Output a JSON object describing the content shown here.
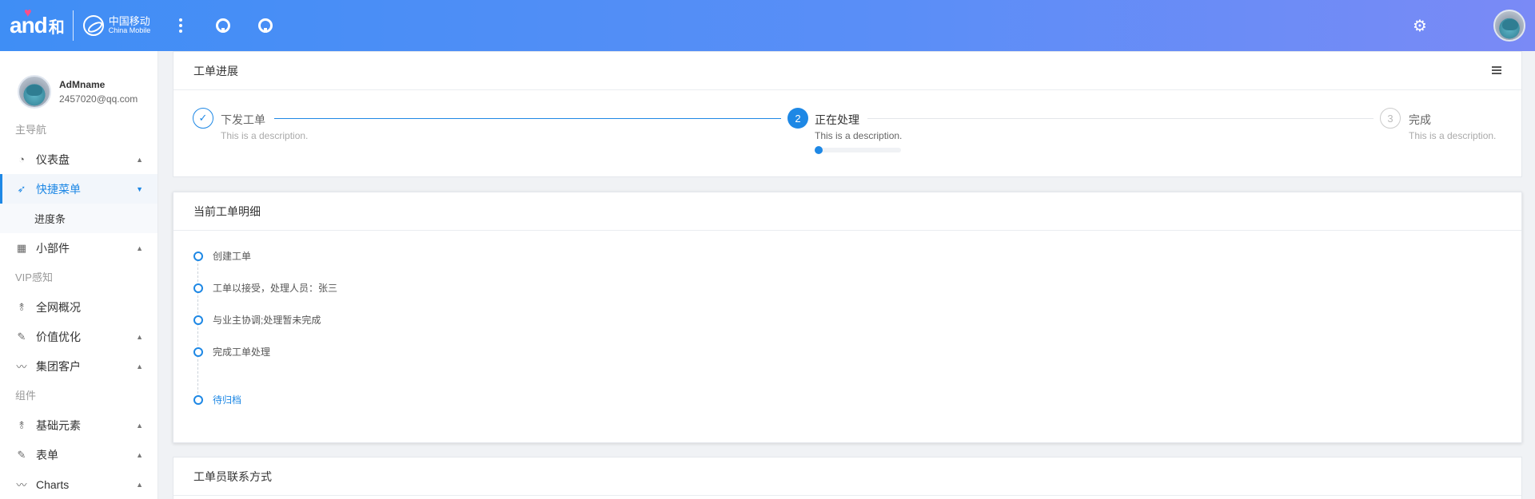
{
  "header": {
    "brand_and": "and",
    "brand_he": "和",
    "cm_zh": "中国移动",
    "cm_en": "China Mobile",
    "icons": [
      "more-vertical-icon",
      "github-icon",
      "github-icon",
      "gear-icon",
      "user-avatar"
    ]
  },
  "sidebar": {
    "user_name": "AdMname",
    "user_email": "2457020@qq.com",
    "groups": [
      {
        "label": "主导航"
      },
      {
        "label": "VIP感知"
      },
      {
        "label": "组件"
      }
    ],
    "items": [
      {
        "label": "仪表盘",
        "icon": "dashboard-icon"
      },
      {
        "label": "快捷菜单",
        "icon": "rocket-icon",
        "active": true
      },
      {
        "label": "进度条",
        "sub": true
      },
      {
        "label": "小部件",
        "icon": "grid-icon"
      },
      {
        "label": "全网概况",
        "icon": "tower-icon"
      },
      {
        "label": "价值优化",
        "icon": "edit-icon"
      },
      {
        "label": "集团客户",
        "icon": "trend-icon"
      },
      {
        "label": "基础元素",
        "icon": "tower-icon"
      },
      {
        "label": "表单",
        "icon": "edit-icon"
      },
      {
        "label": "Charts",
        "icon": "trend-icon"
      }
    ]
  },
  "progress_card": {
    "title": "工单进展",
    "steps": [
      {
        "number": "✓",
        "title": "下发工单",
        "desc": "This is a description."
      },
      {
        "number": "2",
        "title": "正在处理",
        "desc": "This is a description."
      },
      {
        "number": "3",
        "title": "完成",
        "desc": "This is a description."
      }
    ]
  },
  "detail_card": {
    "title": "当前工单明细",
    "timeline": [
      {
        "text": "创建工单"
      },
      {
        "text": "工单以接受，处理人员：张三"
      },
      {
        "text": "与业主协调;处理暂未完成"
      },
      {
        "text": "完成工单处理"
      },
      {
        "text": "待归档",
        "highlight": true
      }
    ]
  },
  "contact_card": {
    "title": "工单员联系方式"
  },
  "colors": {
    "primary": "#1e88e5",
    "header_start": "#3f8ef5",
    "header_end": "#7a8af6"
  }
}
